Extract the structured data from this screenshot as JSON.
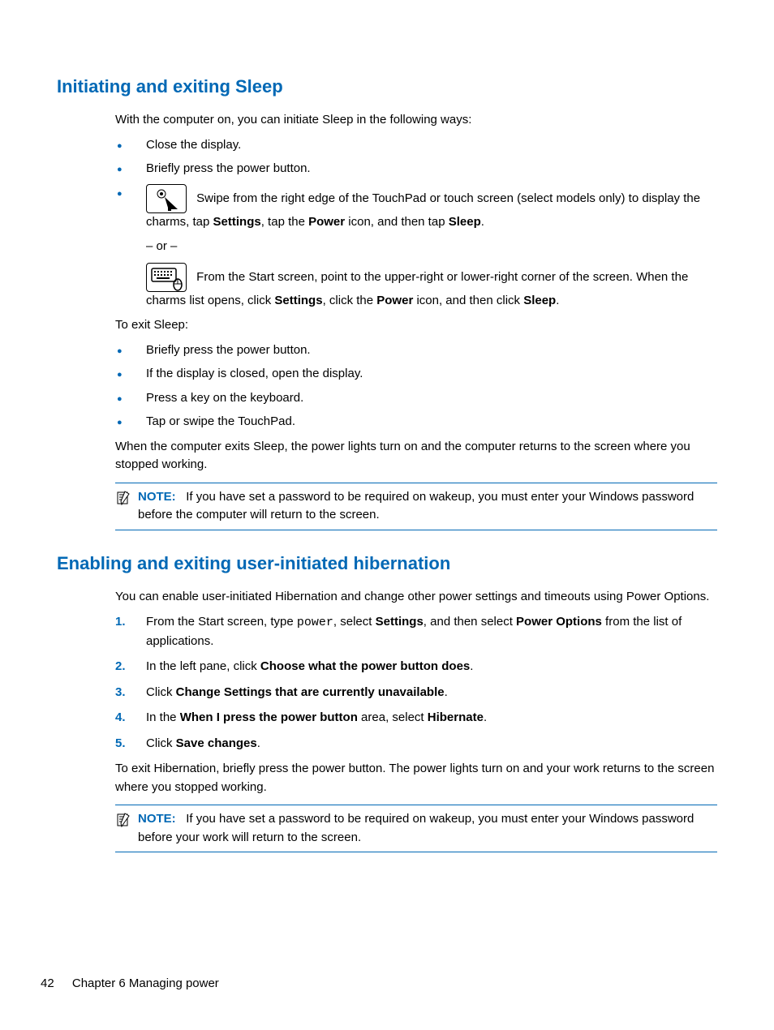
{
  "section1": {
    "heading": "Initiating and exiting Sleep",
    "intro": "With the computer on, you can initiate Sleep in the following ways:",
    "bullets1": {
      "b1": "Close the display.",
      "b2": "Briefly press the power button.",
      "b3a_pre": "Swipe from the right edge of the TouchPad or touch screen (select models only) to display the charms, tap ",
      "b3a_s": "Settings",
      "b3a_mid1": ", tap the ",
      "b3a_p": "Power",
      "b3a_mid2": " icon, and then tap ",
      "b3a_sl": "Sleep",
      "b3a_end": ".",
      "or": "– or –",
      "b3b_pre": "From the Start screen, point to the upper-right or lower-right corner of the screen. When the charms list opens, click ",
      "b3b_s": "Settings",
      "b3b_mid1": ", click the ",
      "b3b_p": "Power",
      "b3b_mid2": " icon, and then click ",
      "b3b_sl": "Sleep",
      "b3b_end": "."
    },
    "exit_intro": "To exit Sleep:",
    "bullets2": {
      "b1": "Briefly press the power button.",
      "b2": "If the display is closed, open the display.",
      "b3": "Press a key on the keyboard.",
      "b4": "Tap or swipe the TouchPad."
    },
    "outro": "When the computer exits Sleep, the power lights turn on and the computer returns to the screen where you stopped working.",
    "note_label": "NOTE:",
    "note": "If you have set a password to be required on wakeup, you must enter your Windows password before the computer will return to the screen."
  },
  "section2": {
    "heading": "Enabling and exiting user-initiated hibernation",
    "intro": "You can enable user-initiated Hibernation and change other power settings and timeouts using Power Options.",
    "s1_pre": "From the Start screen, type ",
    "s1_code": "power",
    "s1_mid1": ", select ",
    "s1_b1": "Settings",
    "s1_mid2": ", and then select ",
    "s1_b2": "Power Options",
    "s1_end": " from the list of applications.",
    "s2_pre": "In the left pane, click ",
    "s2_b": "Choose what the power button does",
    "s2_end": ".",
    "s3_pre": "Click ",
    "s3_b": "Change Settings that are currently unavailable",
    "s3_end": ".",
    "s4_pre": "In the ",
    "s4_b1": "When I press the power button",
    "s4_mid": " area, select ",
    "s4_b2": "Hibernate",
    "s4_end": ".",
    "s5_pre": "Click ",
    "s5_b": "Save changes",
    "s5_end": ".",
    "outro": "To exit Hibernation, briefly press the power button. The power lights turn on and your work returns to the screen where you stopped working.",
    "note_label": "NOTE:",
    "note": "If you have set a password to be required on wakeup, you must enter your Windows password before your work will return to the screen."
  },
  "footer": {
    "page": "42",
    "chapter": "Chapter 6   Managing power"
  }
}
